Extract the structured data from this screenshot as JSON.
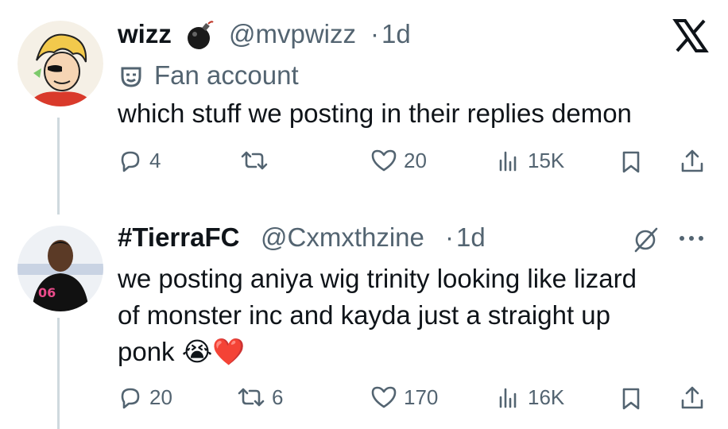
{
  "tweets": [
    {
      "name": "wizz",
      "handle": "@mvpwizz",
      "separator": "·",
      "time": "1d",
      "label": "Fan account",
      "text": "which stuff we posting in their replies demon",
      "replies": "4",
      "retweets": "",
      "likes": "20",
      "views": "15K"
    },
    {
      "name": "#TierraFC",
      "handle": "@Cxmxthzine",
      "separator": "·",
      "time": "1d",
      "text_lines": [
        "we posting aniya wig trinity looking like lizard",
        "of monster inc and kayda just a straight up",
        "ponk"
      ],
      "emoji": "😭❤️",
      "replies": "20",
      "retweets": "6",
      "likes": "170",
      "views": "16K",
      "jersey": "06"
    }
  ],
  "icons": {
    "verified_badge": "bomb-icon",
    "platform": "x-logo-icon",
    "label_icon": "theater-mask-icon",
    "more": "more-icon",
    "grok": "grok-icon"
  },
  "colors": {
    "text": "#0f1419",
    "secondary": "#536471",
    "line": "#cfd9de"
  }
}
